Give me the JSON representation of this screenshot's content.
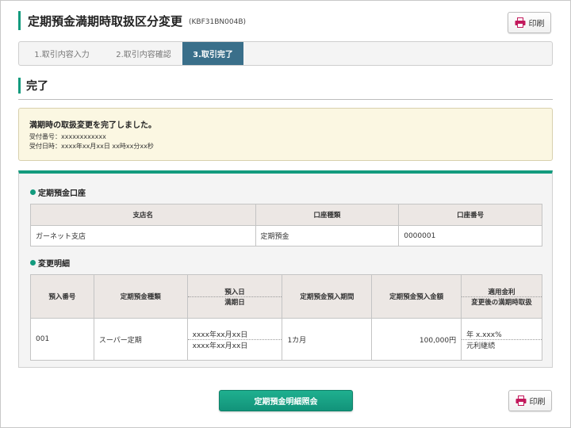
{
  "header": {
    "title": "定期預金満期時取扱区分変更",
    "code": "(KBF31BN004B)",
    "print_label": "印刷"
  },
  "steps": [
    {
      "label": "1.取引内容入力"
    },
    {
      "label": "2.取引内容確認"
    },
    {
      "label": "3.取引完了"
    }
  ],
  "section": {
    "title": "完了"
  },
  "notice": {
    "message": "満期時の取扱変更を完了しました。",
    "receipt_no": "受付番号：xxxxxxxxxxxx",
    "receipt_datetime": "受付日時：xxxx年xx月xx日 xx時xx分xx秒"
  },
  "account": {
    "title": "定期預金口座",
    "headers": [
      "支店名",
      "口座種類",
      "口座番号"
    ],
    "row": [
      "ガーネット支店",
      "定期預金",
      "0000001"
    ]
  },
  "detail": {
    "title": "変更明細",
    "headers": {
      "deposit_no": "預入番号",
      "type": "定期預金種類",
      "date_top": "預入日",
      "date_bottom": "満期日",
      "period": "定期預金預入期間",
      "amount": "定期預金預入金額",
      "rate_top": "適用金利",
      "rate_bottom": "変更後の満期時取扱"
    },
    "row": {
      "deposit_no": "001",
      "type": "スーパー定期",
      "deposit_date": "xxxx年xx月xx日",
      "maturity_date": "xxxx年xx月xx日",
      "period": "1カ月",
      "amount": "100,000円",
      "rate": "年 x.xxx%",
      "handling": "元利継続"
    }
  },
  "footer": {
    "main_button": "定期預金明細照会",
    "print_label": "印刷"
  },
  "colors": {
    "accent": "#139b7e",
    "step_active": "#3a6f8a",
    "notice_bg": "#fbf7e2",
    "print_icon": "#c2185b"
  }
}
